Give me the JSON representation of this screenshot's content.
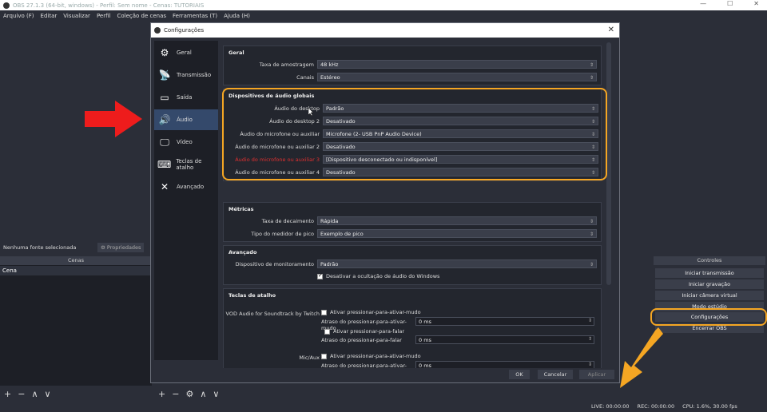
{
  "window": {
    "title": "OBS 27.1.3 (64-bit, windows) - Perfil: Sem nome - Cenas: TUTORIAIS",
    "minimize": "—",
    "maximize": "☐",
    "close": "✕"
  },
  "menu": [
    "Arquivo (F)",
    "Editar",
    "Visualizar",
    "Perfil",
    "Coleção de cenas",
    "Ferramentas (T)",
    "Ajuda (H)"
  ],
  "sources_bar": {
    "no_selection": "Nenhuma fonte selecionada",
    "properties": "Propriedades"
  },
  "scenes": {
    "header": "Cenas",
    "items": [
      "Cena"
    ]
  },
  "controls": {
    "header": "Controles",
    "buttons": [
      "Iniciar transmissão",
      "Iniciar gravação",
      "Iniciar câmera virtual",
      "Modo estúdio",
      "Configurações",
      "Encerrar OBS"
    ]
  },
  "status": {
    "live": "LIVE: 00:00:00",
    "rec": "REC: 00:00:00",
    "cpu": "CPU: 1.6%, 30.00 fps"
  },
  "dialog": {
    "title": "Configurações",
    "close": "✕",
    "nav": [
      "Geral",
      "Transmissão",
      "Saída",
      "Áudio",
      "Vídeo",
      "Teclas de atalho",
      "Avançado"
    ],
    "geral": {
      "title": "Geral",
      "rows": [
        {
          "label": "Taxa de amostragem",
          "value": "48 kHz"
        },
        {
          "label": "Canais",
          "value": "Estéreo"
        }
      ]
    },
    "dispositivos": {
      "title": "Dispositivos de áudio globais",
      "rows": [
        {
          "label": "Áudio do desktop",
          "value": "Padrão"
        },
        {
          "label": "Áudio do desktop 2",
          "value": "Desativado"
        },
        {
          "label": "Áudio do microfone ou auxiliar",
          "value": "Microfone (2- USB PnP Audio Device)"
        },
        {
          "label": "Áudio do microfone ou auxiliar 2",
          "value": "Desativado"
        },
        {
          "label": "Áudio do microfone ou auxiliar 3",
          "value": "[Dispositivo desconectado ou indisponível]"
        },
        {
          "label": "Áudio do microfone ou auxiliar 4",
          "value": "Desativado"
        }
      ]
    },
    "metricas": {
      "title": "Métricas",
      "rows": [
        {
          "label": "Taxa de decaimento",
          "value": "Rápida"
        },
        {
          "label": "Tipo do medidor de pico",
          "value": "Exemplo de pico"
        }
      ]
    },
    "avancado": {
      "title": "Avançado",
      "rows": [
        {
          "label": "Dispositivo de monitoramento",
          "value": "Padrão"
        }
      ],
      "checkbox": "Desativar a ocultação de áudio do Windows"
    },
    "teclas": {
      "title": "Teclas de atalho",
      "vod_label": "VOD Audio for Soundtrack by Twitch",
      "mic_label": "Mic/Aux",
      "push_to_mute": "Ativar pressionar-para-ativar-mudo",
      "push_to_mute_delay": "Atraso do pressionar-para-ativar-mudo",
      "push_to_talk": "Ativar pressionar-para-falar",
      "push_to_talk_delay": "Atraso do pressionar-para-falar",
      "ms": "0 ms"
    },
    "buttons": {
      "ok": "OK",
      "cancel": "Cancelar",
      "apply": "Aplicar"
    }
  },
  "colors": {
    "accent": "#f5a623",
    "arrow_red": "#ee1c1c",
    "nav_active": "#34496b"
  }
}
